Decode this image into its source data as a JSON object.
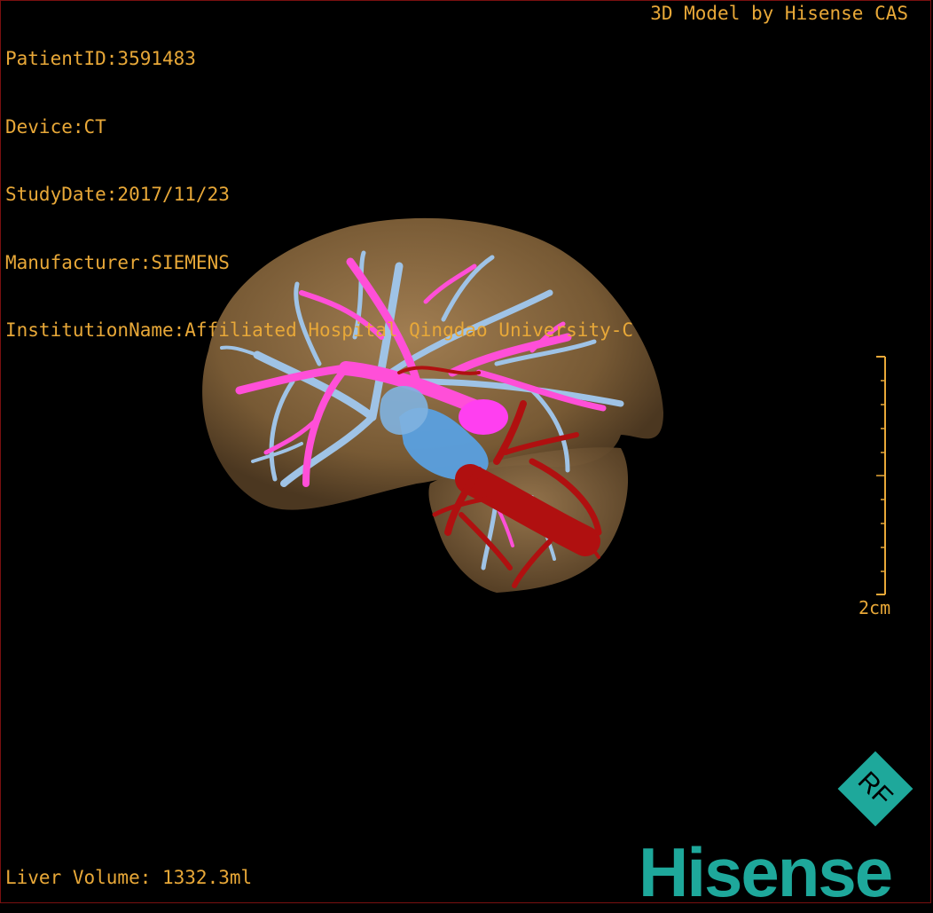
{
  "overlay": {
    "patient_id": "PatientID:3591483",
    "device": "Device:CT",
    "study_date": "StudyDate:2017/11/23",
    "manufacturer": "Manufacturer:SIEMENS",
    "institution": "InstitutionName:Affiliated Hospital Qingdao University-C",
    "credit": "3D Model by Hisense CAS",
    "liver_volume": "Liver Volume: 1332.3ml",
    "scale_label": "2cm"
  },
  "brand": {
    "name": "Hisense",
    "badge": "RF",
    "color": "#1ea89b"
  },
  "colors": {
    "text": "#e8a838",
    "liver": "#8a6a3e",
    "portal_vein": "#ff4fd8",
    "hepatic_vein": "#9fc3e6",
    "artery": "#b01010",
    "ivc": "#5aa0e0"
  }
}
